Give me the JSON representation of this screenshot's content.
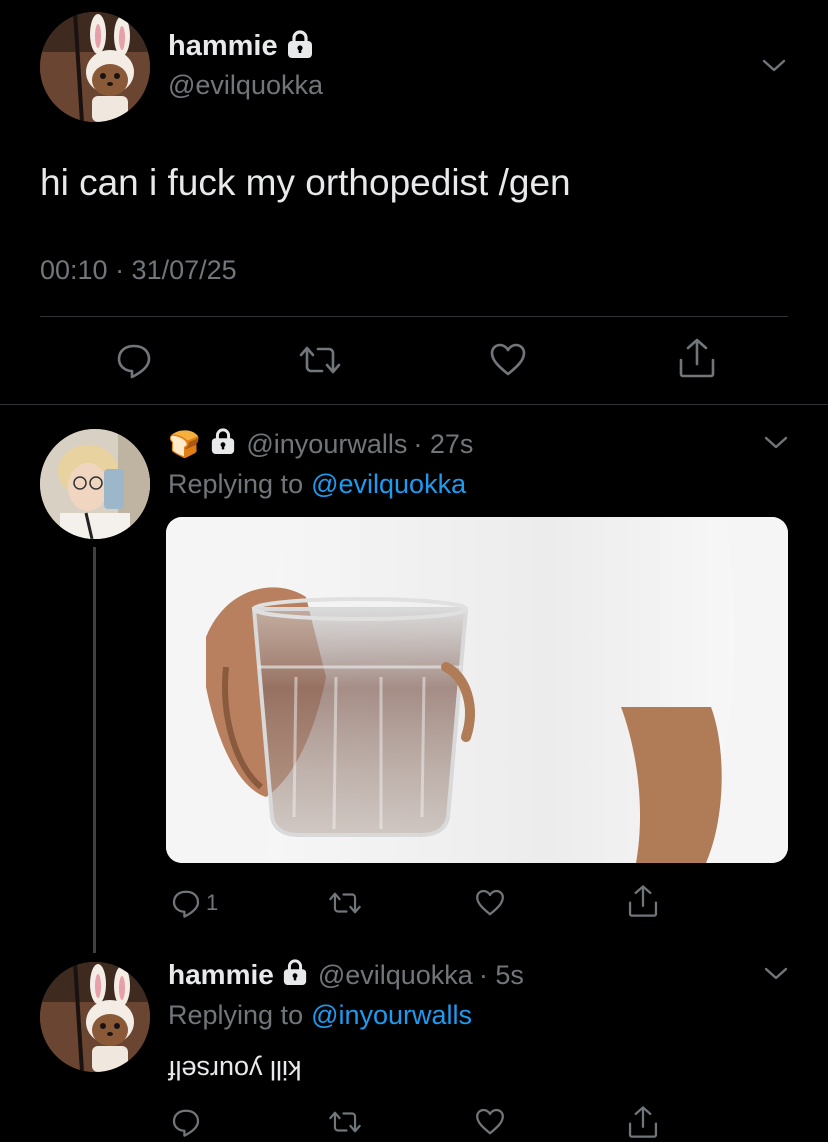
{
  "tweet": {
    "author_name": "hammie",
    "author_handle": "@evilquokka",
    "text": "hi can i fuck my orthopedist /gen",
    "timestamp": "00:10 · 31/07/25"
  },
  "reply1": {
    "emoji": "🍞",
    "handle": "@inyourwalls",
    "time": "· 27s",
    "replying_prefix": "Replying to",
    "replying_to": "@evilquokka",
    "reply_count": "1"
  },
  "reply2": {
    "author_name": "hammie",
    "handle": "@evilquokka",
    "time": "· 5s",
    "replying_prefix": "Replying to",
    "replying_to": "@inyourwalls",
    "text": "kill yourself",
    "text_style": "upside-down"
  },
  "colors": {
    "background": "#000000",
    "text": "#e7e9ea",
    "secondary": "#71767b",
    "link": "#1d9bf0",
    "divider": "#2f3336"
  },
  "icons": [
    "chevron-down-icon",
    "lock-icon",
    "reply-icon",
    "retweet-icon",
    "like-icon",
    "share-icon",
    "bread-emoji"
  ]
}
